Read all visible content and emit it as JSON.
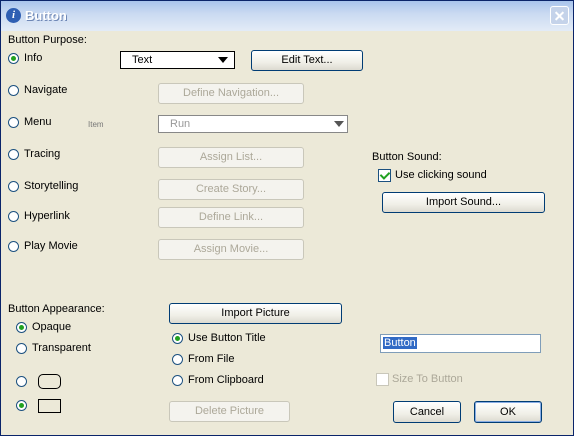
{
  "window": {
    "title": "Button"
  },
  "purpose": {
    "heading": "Button Purpose:",
    "options": [
      {
        "label": "Info",
        "selected": true
      },
      {
        "label": "Navigate",
        "selected": false
      },
      {
        "label": "Menu",
        "selected": false
      },
      {
        "label": "Tracing",
        "selected": false
      },
      {
        "label": "Storytelling",
        "selected": false
      },
      {
        "label": "Hyperlink",
        "selected": false
      },
      {
        "label": "Play Movie",
        "selected": false
      }
    ],
    "info_combo_value": "Text",
    "edit_text_button": "Edit Text...",
    "define_navigation_button": "Define Navigation...",
    "menu_small_label": "Item",
    "menu_combo_value": "Run",
    "assign_list_button": "Assign List...",
    "create_story_button": "Create Story...",
    "define_link_button": "Define Link...",
    "assign_movie_button": "Assign Movie..."
  },
  "sound": {
    "heading": "Button Sound:",
    "use_clicking_label": "Use clicking sound",
    "use_clicking_checked": true,
    "import_sound_button": "Import Sound..."
  },
  "appearance": {
    "heading": "Button Appearance:",
    "opaque_label": "Opaque",
    "transparent_label": "Transparent",
    "opaque_selected": true,
    "shape_rounded_selected": false,
    "shape_rect_selected": true
  },
  "picture": {
    "import_picture_button": "Import Picture",
    "use_button_title_label": "Use Button Title",
    "from_file_label": "From File",
    "from_clipboard_label": "From Clipboard",
    "source_selected": "Use Button Title",
    "delete_picture_button": "Delete Picture",
    "title_field_value": "Button",
    "size_to_button_label": "Size To Button",
    "size_to_button_checked": false
  },
  "dialog_buttons": {
    "cancel": "Cancel",
    "ok": "OK"
  }
}
